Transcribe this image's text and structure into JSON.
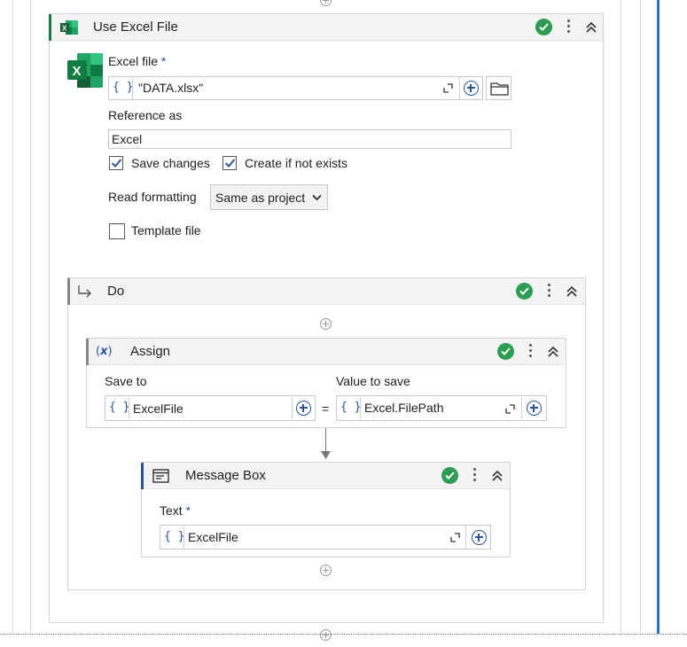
{
  "excel_scope": {
    "title": "Use Excel File",
    "excel_file_label": "Excel file",
    "required_mark": "*",
    "excel_file_value": "\"DATA.xlsx\"",
    "reference_as_label": "Reference as",
    "reference_as_value": "Excel",
    "save_changes_label": "Save changes",
    "save_changes_checked": true,
    "create_if_not_exists_label": "Create if not exists",
    "create_if_not_exists_checked": true,
    "read_formatting_label": "Read formatting",
    "read_formatting_value": "Same as project",
    "template_file_label": "Template file",
    "template_file_checked": false
  },
  "do_block": {
    "title": "Do"
  },
  "assign": {
    "title": "Assign",
    "save_to_label": "Save to",
    "save_to_value": "ExcelFile",
    "equals": "=",
    "value_to_save_label": "Value to save",
    "value_to_save_value": "Excel.FilePath"
  },
  "message_box": {
    "title": "Message Box",
    "text_label": "Text",
    "required_mark": "*",
    "text_value": "ExcelFile"
  },
  "icons": {
    "brace": "{ }",
    "excel": "excel-icon",
    "status": "check-circle-icon",
    "menu": "kebab-icon",
    "collapse": "double-chevron-up-icon"
  },
  "colors": {
    "accent_blue": "#2b5797",
    "success_green": "#2e9c52",
    "excel_green": "#1a7a4a",
    "header_bg": "#f3f3f3",
    "selection_border": "#1f6fd1"
  }
}
